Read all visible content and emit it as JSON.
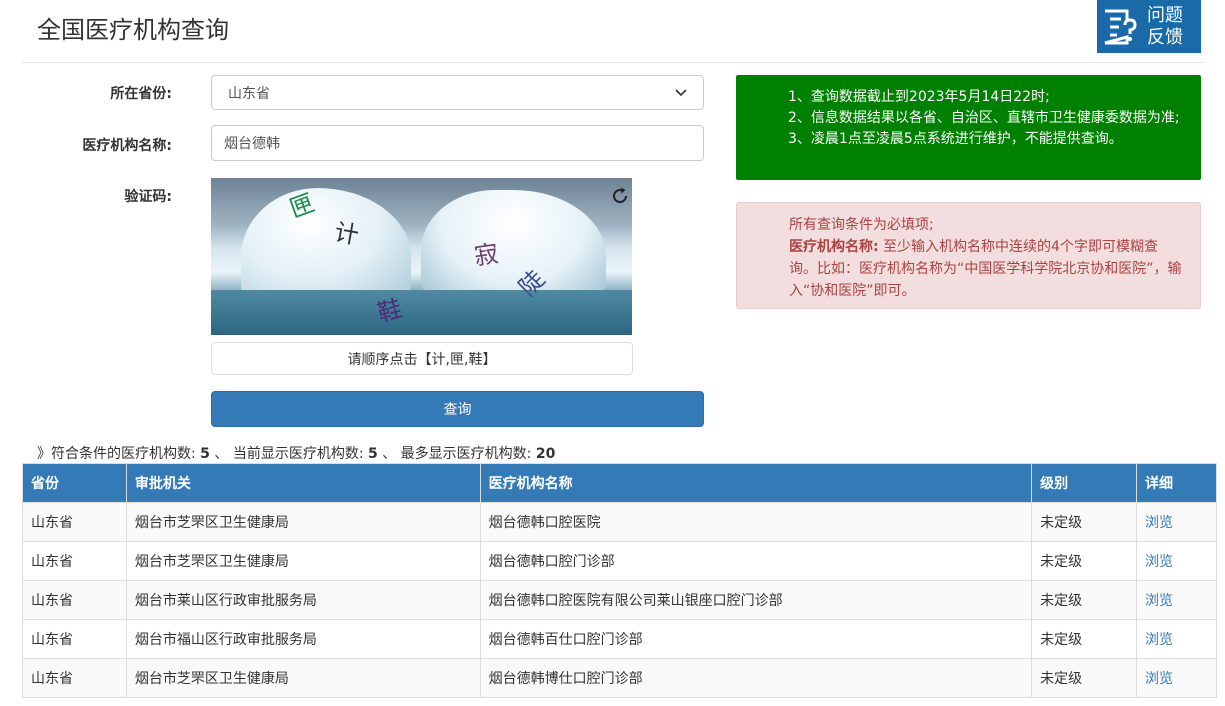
{
  "page": {
    "title": "全国医疗机构查询"
  },
  "feedback": {
    "label_line1": "问题",
    "label_line2": "反馈"
  },
  "form": {
    "province_label": "所在省份:",
    "province_value": "山东省",
    "name_label": "医疗机构名称:",
    "name_value": "烟台德韩",
    "captcha_label": "验证码:",
    "captcha_chars": [
      "匣",
      "计",
      "寂",
      "陡",
      "鞋"
    ],
    "captcha_hint": "请顺序点击【计,匣,鞋】",
    "submit_label": "查询"
  },
  "notice_green": {
    "lines": [
      "1、查询数据截止到2023年5月14日22时;",
      "2、信息数据结果以各省、自治区、直辖市卫生健康委数据为准;",
      "3、凌晨1点至凌晨5点系统进行维护，不能提供查询。"
    ]
  },
  "notice_red": {
    "line1": "所有查询条件为必填项;",
    "bold_prefix": "医疗机构名称:",
    "line2": " 至少输入机构名称中连续的4个字即可模糊查询。比如：医疗机构名称为“中国医学科学院北京协和医院”，输入“协和医院”即可。"
  },
  "summary": {
    "prefix": "》符合条件的医疗机构数:",
    "match_count": "5",
    "sep1": "、 当前显示医疗机构数:",
    "shown_count": "5",
    "sep2": "、 最多显示医疗机构数:",
    "max_count": "20"
  },
  "table": {
    "headers": [
      "省份",
      "审批机关",
      "医疗机构名称",
      "级别",
      "详细"
    ],
    "rows": [
      [
        "山东省",
        "烟台市芝罘区卫生健康局",
        "烟台德韩口腔医院",
        "未定级",
        "浏览"
      ],
      [
        "山东省",
        "烟台市芝罘区卫生健康局",
        "烟台德韩口腔门诊部",
        "未定级",
        "浏览"
      ],
      [
        "山东省",
        "烟台市莱山区行政审批服务局",
        "烟台德韩口腔医院有限公司莱山银座口腔门诊部",
        "未定级",
        "浏览"
      ],
      [
        "山东省",
        "烟台市福山区行政审批服务局",
        "烟台德韩百仕口腔门诊部",
        "未定级",
        "浏览"
      ],
      [
        "山东省",
        "烟台市芝罘区卫生健康局",
        "烟台德韩博仕口腔门诊部",
        "未定级",
        "浏览"
      ]
    ]
  },
  "colors": {
    "primary": "#337ab7",
    "notice_green": "#008000",
    "notice_red_bg": "#f2dede",
    "notice_red_text": "#a94442"
  }
}
